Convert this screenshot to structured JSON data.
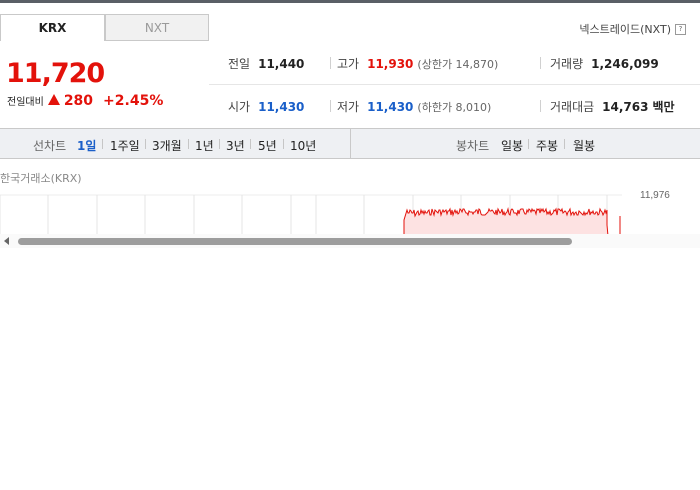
{
  "tabs": [
    {
      "label": "KRX",
      "active": true
    },
    {
      "label": "NXT",
      "active": false
    }
  ],
  "nxt_link": {
    "label": "넥스트레이드(NXT)",
    "icon": "help-icon"
  },
  "price": {
    "current": "11,720",
    "change_label": "전일대비",
    "change_value": "280",
    "change_rate": "+2.45%",
    "direction": "up",
    "up_color": "#e3120b",
    "down_color": "#1a5fc9"
  },
  "stats": {
    "prev_close": {
      "label": "전일",
      "value": "11,440"
    },
    "high": {
      "label": "고가",
      "value": "11,930",
      "sub": "(상한가 14,870)"
    },
    "volume": {
      "label": "거래량",
      "value": "1,246,099"
    },
    "open": {
      "label": "시가",
      "value": "11,430"
    },
    "low": {
      "label": "저가",
      "value": "11,430",
      "sub": "(하한가 8,010)"
    },
    "amount": {
      "label": "거래대금",
      "value": "14,763",
      "unit": "백만"
    }
  },
  "line_chart": {
    "title": "선차트",
    "periods": [
      "1일",
      "1주일",
      "3개월",
      "1년",
      "3년",
      "5년",
      "10년"
    ],
    "active": "1일"
  },
  "candle_chart": {
    "title": "봉차트",
    "periods": [
      "일봉",
      "주봉",
      "월봉"
    ]
  },
  "chart": {
    "source_label": "한국거래소(KRX)",
    "y_max_label": "11,976"
  }
}
